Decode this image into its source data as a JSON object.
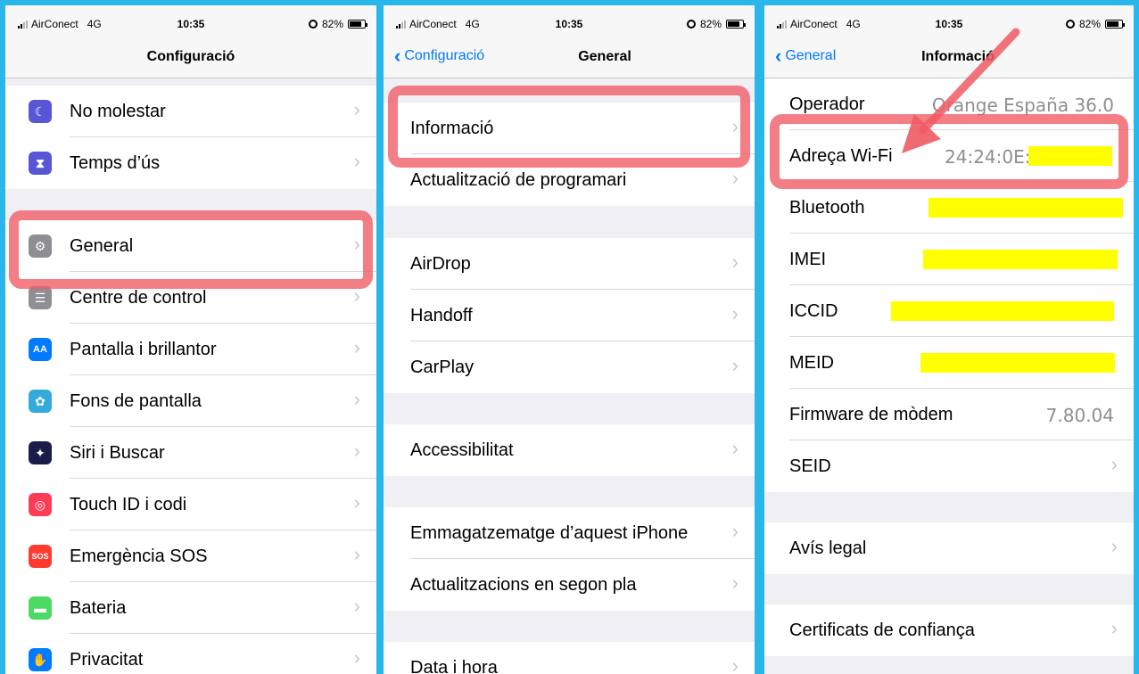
{
  "status": {
    "carrier": "AirConect",
    "network": "4G",
    "time": "10:35",
    "battery": "82%",
    "battery_level": 0.82
  },
  "panel1": {
    "title": "Configuració",
    "rows": [
      {
        "label": "No molestar",
        "icon": "moon-icon",
        "color": "#5856d6",
        "glyph": "☾"
      },
      {
        "label": "Temps d’ús",
        "icon": "hourglass-icon",
        "color": "#5856d6",
        "glyph": "⧗"
      },
      {
        "label": "General",
        "icon": "gear-icon",
        "color": "#8e8e93",
        "glyph": "⚙"
      },
      {
        "label": "Centre de control",
        "icon": "switches-icon",
        "color": "#8e8e93",
        "glyph": "☰"
      },
      {
        "label": "Pantalla i brillantor",
        "icon": "text-size-icon",
        "color": "#007aff",
        "glyph": "AA"
      },
      {
        "label": "Fons de pantalla",
        "icon": "flower-icon",
        "color": "#34aadc",
        "glyph": "✿"
      },
      {
        "label": "Siri i Buscar",
        "icon": "siri-icon",
        "color": "#1c1c4a",
        "glyph": "✦"
      },
      {
        "label": "Touch ID i codi",
        "icon": "fingerprint-icon",
        "color": "#ff3b55",
        "glyph": "◎"
      },
      {
        "label": "Emergència SOS",
        "icon": "sos-icon",
        "color": "#ff3b30",
        "glyph": "SOS"
      },
      {
        "label": "Bateria",
        "icon": "battery-icon",
        "color": "#4cd964",
        "glyph": "▬"
      },
      {
        "label": "Privacitat",
        "icon": "hand-icon",
        "color": "#007aff",
        "glyph": "✋"
      }
    ]
  },
  "panel2": {
    "back": "Configuració",
    "title": "General",
    "rows": [
      {
        "label": "Informació"
      },
      {
        "label": "Actualització de programari"
      },
      {
        "label": "AirDrop"
      },
      {
        "label": "Handoff"
      },
      {
        "label": "CarPlay"
      },
      {
        "label": "Accessibilitat"
      },
      {
        "label": "Emmagatzematge d’aquest iPhone"
      },
      {
        "label": "Actualitzacions en segon pla"
      },
      {
        "label": "Data i hora"
      }
    ]
  },
  "panel3": {
    "back": "General",
    "title": "Informació",
    "rows": [
      {
        "label": "Operador",
        "value": "Orange España 36.0"
      },
      {
        "label": "Adreça Wi-Fi",
        "value": "24:24:0E:"
      },
      {
        "label": "Bluetooth",
        "value": ""
      },
      {
        "label": "IMEI",
        "value": ""
      },
      {
        "label": "ICCID",
        "value": ""
      },
      {
        "label": "MEID",
        "value": ""
      },
      {
        "label": "Firmware de mòdem",
        "value": "7.80.04"
      },
      {
        "label": "SEID",
        "value": ""
      },
      {
        "label": "Avís legal",
        "value": ""
      },
      {
        "label": "Certificats de confiança",
        "value": ""
      }
    ]
  },
  "colors": {
    "frame": "#29b6ea",
    "highlight": "#f05a64",
    "redaction": "#ffff00",
    "link": "#007aff"
  }
}
